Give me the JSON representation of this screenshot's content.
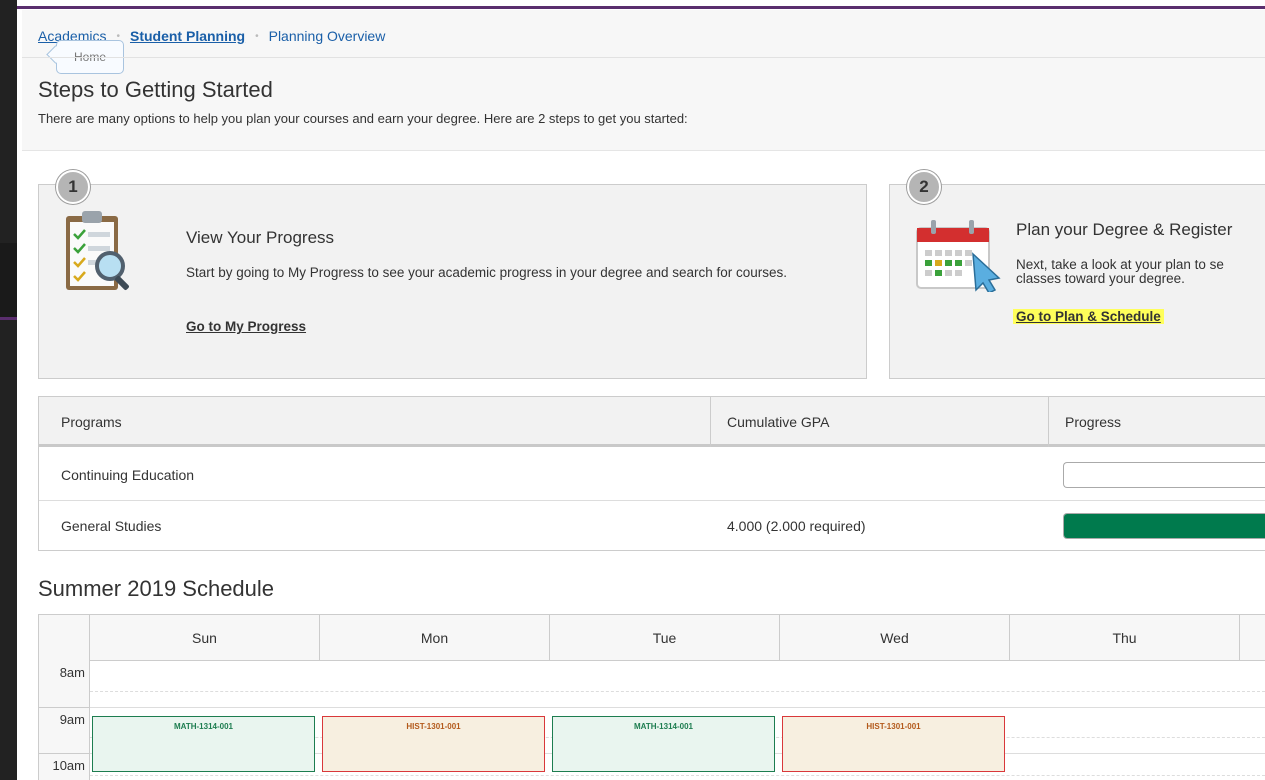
{
  "breadcrumb": {
    "items": [
      "Academics",
      "Student Planning",
      "Planning Overview"
    ],
    "tooltip": "Home"
  },
  "page": {
    "title": "Steps to Getting Started",
    "intro": "There are many options to help you plan your courses and earn your degree. Here are 2 steps to get you started:"
  },
  "steps": [
    {
      "number": "1",
      "title": "View Your Progress",
      "description": "Start by going to My Progress to see your academic progress in your degree and search for courses.",
      "link": "Go to My Progress",
      "icon": "clipboard-magnifier-icon"
    },
    {
      "number": "2",
      "title": "Plan your Degree & Register",
      "description": "Next, take a look at your plan to se classes toward your degree.",
      "link": "Go to Plan & Schedule",
      "icon": "calendar-pointer-icon"
    }
  ],
  "programs": {
    "headers": [
      "Programs",
      "Cumulative GPA",
      "Progress"
    ],
    "rows": [
      {
        "name": "Continuing Education",
        "gpa": "",
        "progress": 0
      },
      {
        "name": "General Studies",
        "gpa": "4.000 (2.000 required)",
        "progress": 1
      }
    ]
  },
  "schedule": {
    "title": "Summer 2019 Schedule",
    "days": [
      "Sun",
      "Mon",
      "Tue",
      "Wed",
      "Thu"
    ],
    "times": [
      "8am",
      "9am",
      "10am"
    ],
    "events": [
      {
        "label": "MATH-1314-001",
        "day": "Sun",
        "kind": "math"
      },
      {
        "label": "HIST-1301-001",
        "day": "Mon",
        "kind": "hist"
      },
      {
        "label": "MATH-1314-001",
        "day": "Tue",
        "kind": "math"
      },
      {
        "label": "HIST-1301-001",
        "day": "Wed",
        "kind": "hist"
      }
    ]
  },
  "colors": {
    "link": "#1a5fa8",
    "progress_fill": "#007a4d",
    "highlight": "#ffff5a",
    "math_border": "#1d7d50",
    "hist_border": "#d9383a",
    "accent_purple": "#5a2e6e"
  }
}
